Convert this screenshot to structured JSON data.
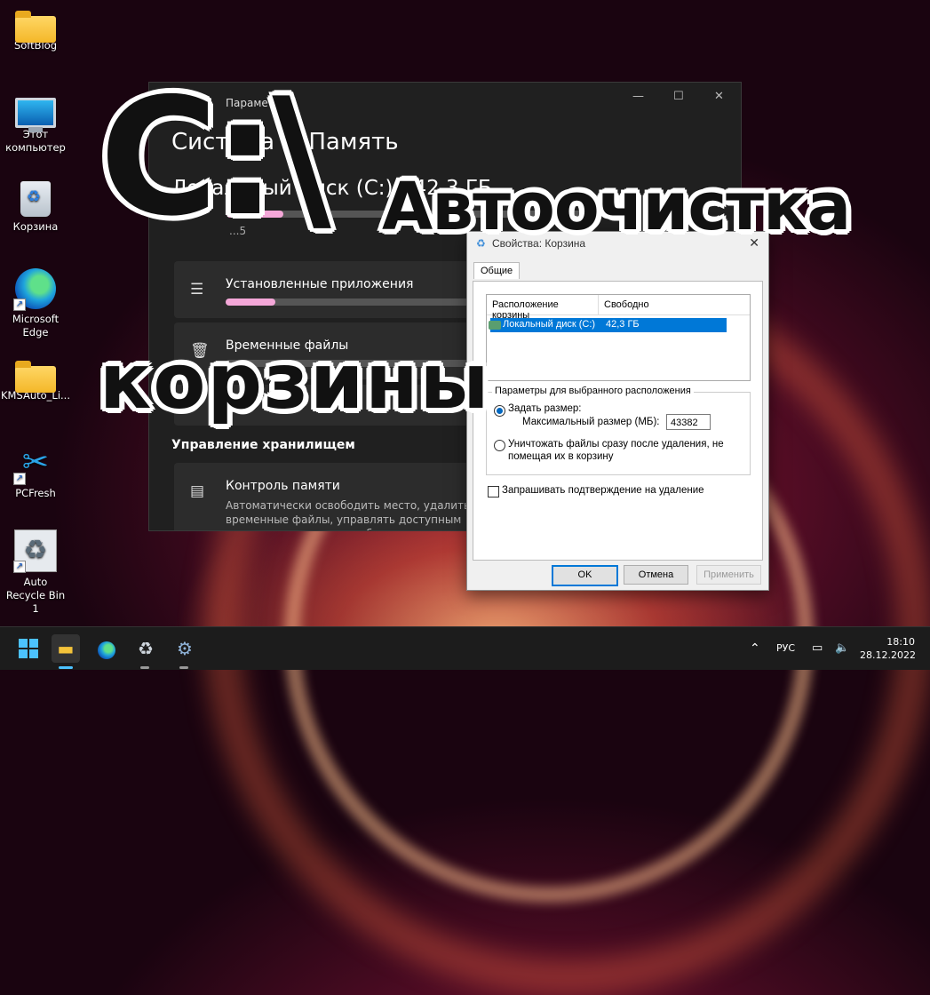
{
  "desktop": {
    "icons": [
      {
        "label": "SoftBlog"
      },
      {
        "label": "Этот компьютер"
      },
      {
        "label": "Корзина"
      },
      {
        "label": "Microsoft Edge"
      },
      {
        "label": "KMSAuto_Li..."
      },
      {
        "label": "PCFresh"
      },
      {
        "label": "Auto Recycle Bin 1"
      }
    ]
  },
  "overlay": {
    "drive": "C:\\",
    "line1": "Автоочистка",
    "line2": "корзины"
  },
  "settings": {
    "title": "Параметры",
    "heading": "Система > Память",
    "disk": "Локальный диск (C:) - 42,3 ГБ",
    "disk_sub": "...5",
    "disk_used_fraction": 0.16,
    "cards": [
      {
        "label": "Установленные приложения",
        "fill_fraction": 0.14
      },
      {
        "label": "Временные файлы"
      },
      {
        "label": "..."
      }
    ],
    "section": "Управление хранилищем",
    "storage_sense": {
      "title": "Контроль памяти",
      "desc": "Автоматически освободить место, удалить временные файлы, управлять доступным локально содержимым облака"
    }
  },
  "dialog": {
    "title": "Свойства: Корзина",
    "tab": "Общие",
    "columns": [
      "Расположение корзины",
      "Свободно"
    ],
    "row": {
      "location": "Локальный диск (C:)",
      "free": "42,3 ГБ"
    },
    "group_label": "Параметры для выбранного расположения",
    "set_size": "Задать размер:",
    "max_size_label": "Максимальный размер (МБ):",
    "max_size_value": "43382",
    "delete_now": "Уничтожать файлы сразу после удаления, не помещая их в корзину",
    "confirm_delete": "Запрашивать подтверждение на удаление",
    "ok": "OK",
    "cancel": "Отмена",
    "apply": "Применить"
  },
  "taskbar": {
    "lang": "РУС",
    "time": "18:10",
    "date": "28.12.2022"
  }
}
